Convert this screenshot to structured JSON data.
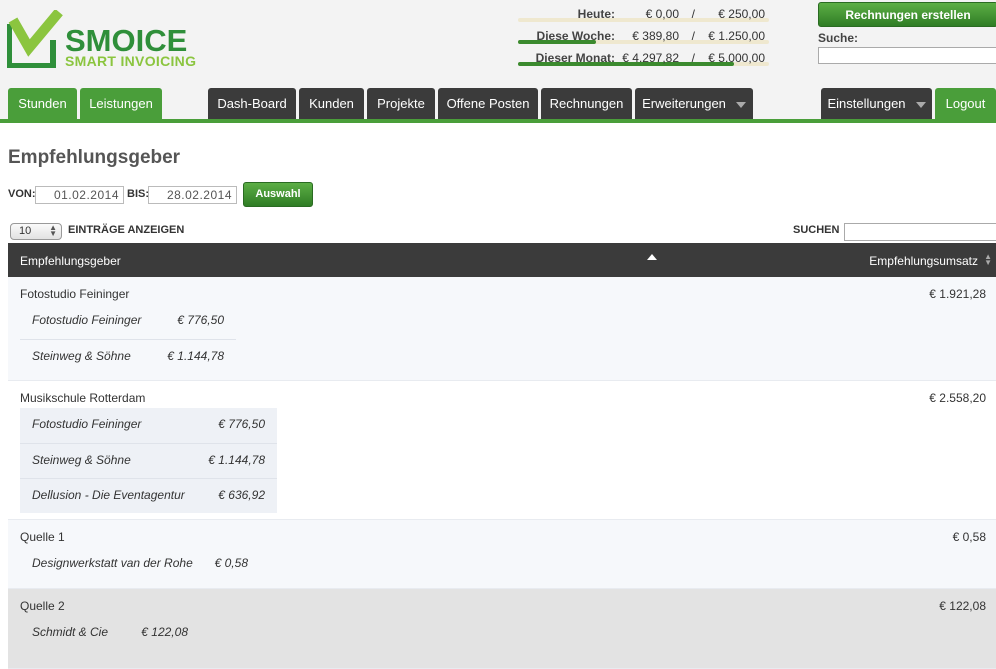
{
  "brand": {
    "name": "SMOICE",
    "tagline": "SMART INVOICING",
    "colors": {
      "primary": "#2f8f3a",
      "accent": "#8bc53f",
      "nav_dark": "#3b3b3b"
    }
  },
  "stats": [
    {
      "label": "Heute:",
      "value": "€ 0,00",
      "sep": "/",
      "goal": "€ 250,00",
      "progress": 0.0
    },
    {
      "label": "Diese Woche:",
      "value": "€ 389,80",
      "sep": "/",
      "goal": "€ 1.250,00",
      "progress": 0.31
    },
    {
      "label": "Dieser Monat:",
      "value": "€ 4.297,82",
      "sep": "/",
      "goal": "€ 5.000,00",
      "progress": 0.86
    }
  ],
  "header": {
    "create_invoices": "Rechnungen erstellen",
    "search_label": "Suche:"
  },
  "nav": {
    "stunden": "Stunden",
    "leistungen": "Leistungen",
    "dashboard": "Dash-Board",
    "kunden": "Kunden",
    "projekte": "Projekte",
    "offene_posten": "Offene Posten",
    "rechnungen": "Rechnungen",
    "erweiterungen": "Erweiterungen",
    "einstellungen": "Einstellungen",
    "logout": "Logout"
  },
  "page": {
    "title": "Empfehlungsgeber"
  },
  "filter": {
    "from_label": "VON:",
    "from_value": "01.02.2014",
    "to_label": "BIS:",
    "to_value": "28.02.2014",
    "apply": "Auswahl"
  },
  "table_controls": {
    "page_size": "10",
    "page_size_label": "EINTRÄGE ANZEIGEN",
    "search_label": "SUCHEN"
  },
  "table": {
    "columns": [
      "Empfehlungsgeber",
      "Empfehlungsumsatz"
    ],
    "groups": [
      {
        "name": "Fotostudio Feininger",
        "total": "€ 1.921,28",
        "items": [
          {
            "name": "Fotostudio Feininger",
            "value": "€ 776,50"
          },
          {
            "name": "Steinweg & Söhne",
            "value": "€ 1.144,78"
          }
        ]
      },
      {
        "name": "Musikschule Rotterdam",
        "total": "€ 2.558,20",
        "items": [
          {
            "name": "Fotostudio Feininger",
            "value": "€ 776,50"
          },
          {
            "name": "Steinweg & Söhne",
            "value": "€ 1.144,78"
          },
          {
            "name": "Dellusion - Die Eventagentur",
            "value": "€ 636,92"
          }
        ]
      },
      {
        "name": "Quelle 1",
        "total": "€ 0,58",
        "items": [
          {
            "name": "Designwerkstatt van der Rohe",
            "value": "€ 0,58"
          }
        ]
      },
      {
        "name": "Quelle 2",
        "total": "€ 122,08",
        "items": [
          {
            "name": "Schmidt & Cie",
            "value": "€ 122,08"
          }
        ]
      }
    ]
  }
}
